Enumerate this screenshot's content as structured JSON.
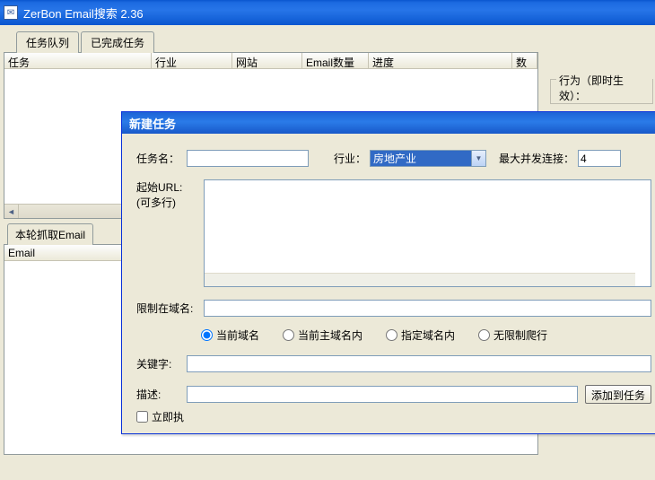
{
  "window": {
    "title": "ZerBon Email搜索 2.36"
  },
  "tabs": {
    "queue": "任务队列",
    "done": "已完成任务"
  },
  "columns": {
    "task": "任务",
    "industry": "行业",
    "site": "网站",
    "emailcount": "Email数量",
    "progress": "进度",
    "num": "数"
  },
  "lowerTab": "本轮抓取Email",
  "lowerCol": "Email",
  "groupbox": {
    "legend": "行为（即时生效）："
  },
  "dialog": {
    "title": "新建任务",
    "labels": {
      "taskname": "任务名：",
      "industry": "行业：",
      "maxconn": "最大并发连接：",
      "starturl_a": "起始URL:",
      "starturl_b": "(可多行)",
      "domain": "限制在域名:",
      "keyword": "关键字:",
      "desc": "描述:"
    },
    "industry_value": "房地产业",
    "maxconn_value": "4",
    "radios": {
      "r1": "当前域名",
      "r2": "当前主域名内",
      "r3": "指定域名内",
      "r4": "无限制爬行"
    },
    "buttons": {
      "add": "添加到任务"
    },
    "checkbox": "立即执"
  }
}
